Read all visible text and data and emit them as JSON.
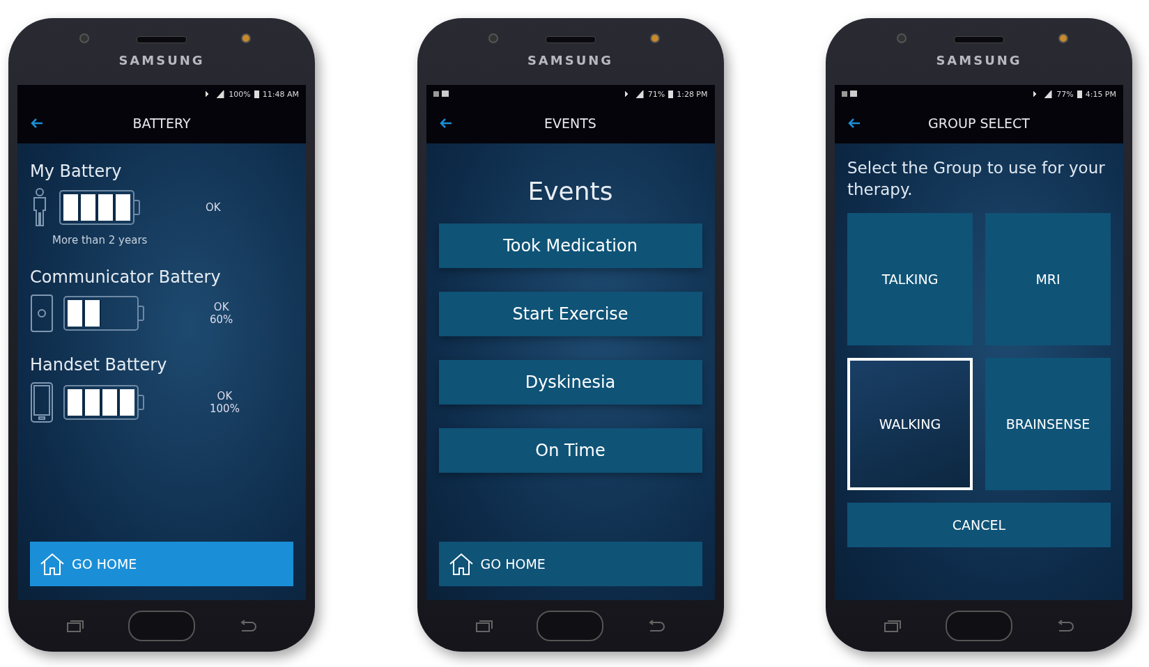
{
  "phones": [
    {
      "brand": "SAMSUNG",
      "status": {
        "battery": "100%",
        "time": "11:48 AM"
      },
      "title": "BATTERY",
      "kind": "battery",
      "batteries": [
        {
          "label": "My Battery",
          "kind": "person",
          "level": 1,
          "status": "OK",
          "note": "More than 2 years"
        },
        {
          "label": "Communicator Battery",
          "kind": "communicator",
          "level": 0.5,
          "status": "OK",
          "detail": "60%"
        },
        {
          "label": "Handset Battery",
          "kind": "handset",
          "level": 1,
          "status": "OK",
          "detail": "100%"
        }
      ],
      "home_button": {
        "label": "GO HOME"
      }
    },
    {
      "brand": "SAMSUNG",
      "status": {
        "battery": "71%",
        "time": "1:28 PM"
      },
      "title": "EVENTS",
      "kind": "events",
      "heading": "Events",
      "events": [
        "Took Medication",
        "Start Exercise",
        "Dyskinesia",
        "On Time"
      ],
      "home_button": {
        "label": "GO HOME"
      }
    },
    {
      "brand": "SAMSUNG",
      "status": {
        "battery": "77%",
        "time": "4:15 PM"
      },
      "title": "GROUP SELECT",
      "kind": "groups",
      "prompt": "Select the Group to use for your therapy.",
      "groups": [
        {
          "label": "TALKING",
          "selected": false
        },
        {
          "label": "MRI",
          "selected": false
        },
        {
          "label": "WALKING",
          "selected": true
        },
        {
          "label": "BRAINSENSE",
          "selected": false
        }
      ],
      "cancel": "CANCEL"
    }
  ]
}
